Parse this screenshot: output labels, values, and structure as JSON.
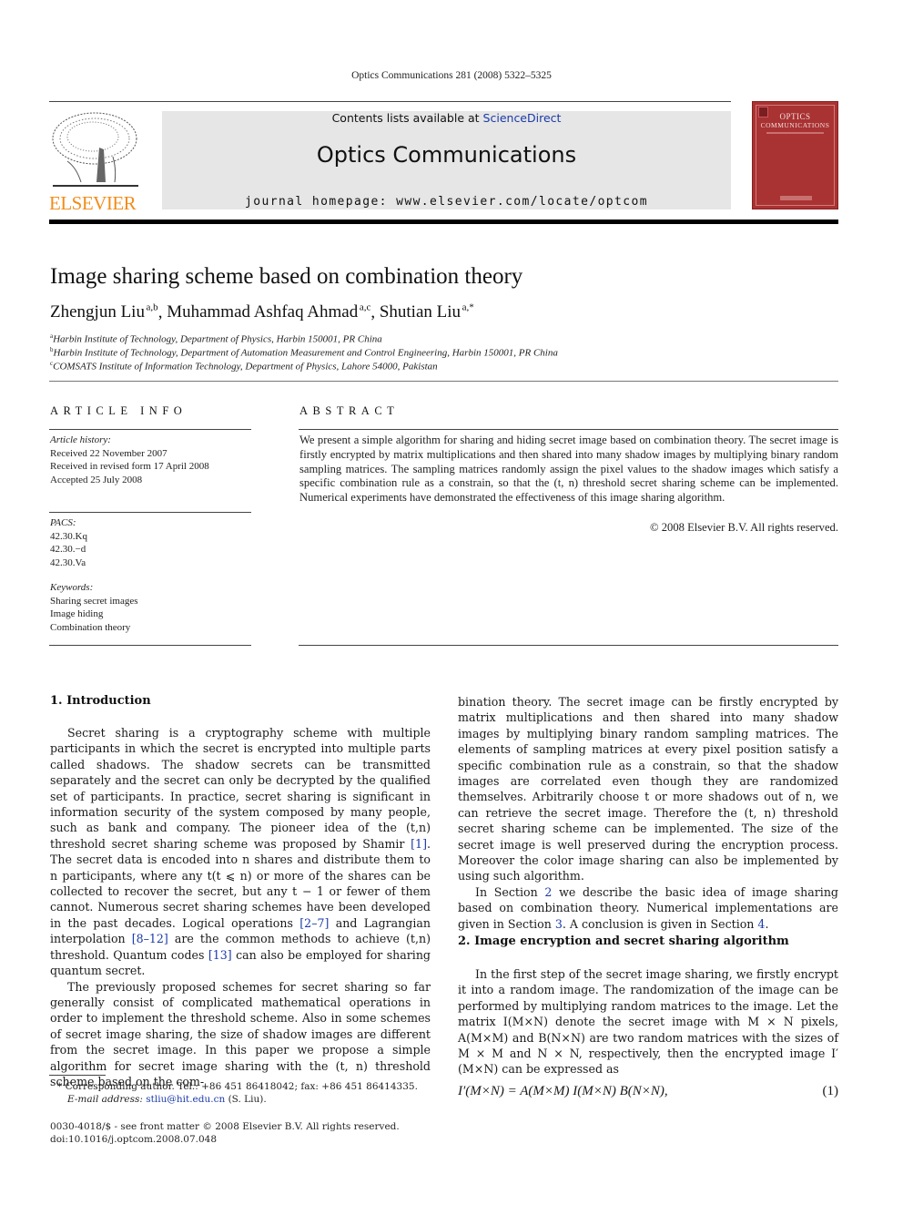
{
  "running_header": "Optics Communications 281 (2008) 5322–5325",
  "banner": {
    "contents_prefix": "Contents lists available at ",
    "contents_link": "ScienceDirect",
    "journal_name": "Optics Communications",
    "homepage": "journal homepage: www.elsevier.com/locate/optcom"
  },
  "publisher_logo": {
    "wordmark": "ELSEVIER",
    "icon": "elsevier-tree-icon",
    "color": "#f28c1a"
  },
  "cover": {
    "title_line1": "Optics",
    "title_line2": "Communications",
    "color": "#a93232"
  },
  "article": {
    "title": "Image sharing scheme based on combination theory",
    "authors": [
      {
        "name": "Zhengjun Liu",
        "sup": "a,b",
        "sep": ", "
      },
      {
        "name": "Muhammad Ashfaq Ahmad",
        "sup": "a,c",
        "sep": ", "
      },
      {
        "name": "Shutian Liu",
        "sup": "a,*",
        "sep": ""
      }
    ],
    "affiliations": [
      {
        "mark": "a",
        "text": "Harbin Institute of Technology, Department of Physics, Harbin 150001, PR China"
      },
      {
        "mark": "b",
        "text": "Harbin Institute of Technology, Department of Automation Measurement and Control Engineering, Harbin 150001, PR China"
      },
      {
        "mark": "c",
        "text": "COMSATS Institute of Information Technology, Department of Physics, Lahore 54000, Pakistan"
      }
    ]
  },
  "article_info": {
    "heading": "ARTICLE INFO",
    "history_label": "Article history:",
    "history": [
      "Received 22 November 2007",
      "Received in revised form 17 April 2008",
      "Accepted 25 July 2008"
    ],
    "pacs_label": "PACS:",
    "pacs": [
      "42.30.Kq",
      "42.30.−d",
      "42.30.Va"
    ],
    "keywords_label": "Keywords:",
    "keywords": [
      "Sharing secret images",
      "Image hiding",
      "Combination theory"
    ]
  },
  "abstract": {
    "heading": "ABSTRACT",
    "text": "We present a simple algorithm for sharing and hiding secret image based on combination theory. The secret image is firstly encrypted by matrix multiplications and then shared into many shadow images by multiplying binary random sampling matrices. The sampling matrices randomly assign the pixel values to the shadow images which satisfy a specific combination rule as a constrain, so that the (t, n) threshold secret sharing scheme can be implemented. Numerical experiments have demonstrated the effectiveness of this image sharing algorithm.",
    "copyright": "© 2008 Elsevier B.V. All rights reserved."
  },
  "section1": {
    "heading": "1. Introduction",
    "p1_a": "Secret sharing is a cryptography scheme with multiple participants in which the secret is encrypted into multiple parts called shadows. The shadow secrets can be transmitted separately and the secret can only be decrypted by the qualified set of participants. In practice, secret sharing is significant in information security of the system composed by many people, such as bank and company. The pioneer idea of the (t,n) threshold secret sharing scheme was proposed by Shamir ",
    "ref1": "[1]",
    "p1_b": ". The secret data is encoded into n shares and distribute them to n participants, where any t(t ⩽ n) or more of the shares can be collected to recover the secret, but any t − 1 or fewer of them cannot. Numerous secret sharing schemes have been developed in the past decades. Logical operations ",
    "ref2": "[2–7]",
    "p1_c": " and Lagrangian interpolation ",
    "ref3": "[8–12]",
    "p1_d": " are the common methods to achieve (t,n) threshold. Quantum codes ",
    "ref4": "[13]",
    "p1_e": " can also be employed for sharing quantum secret.",
    "p2": "The previously proposed schemes for secret sharing so far generally consist of complicated mathematical operations in order to implement the threshold scheme. Also in some schemes of secret image sharing, the size of shadow images are different from the secret image. In this paper we propose a simple algorithm for secret image sharing with the (t, n) threshold scheme based on the com-",
    "p2_cont": "bination theory. The secret image can be firstly encrypted by matrix multiplications and then shared into many shadow images by multiplying binary random sampling matrices. The elements of sampling matrices at every pixel position satisfy a specific combination rule as a constrain, so that the shadow images are correlated even though they are randomized themselves. Arbitrarily choose t or more shadows out of n, we can retrieve the secret image. Therefore the (t, n) threshold secret sharing scheme can be implemented. The size of the secret image is well preserved during the encryption process. Moreover the color image sharing can also be implemented by using such algorithm.",
    "p3_a": "In Section ",
    "p3_s2": "2",
    "p3_b": " we describe the basic idea of image sharing based on combination theory. Numerical implementations are given in Section ",
    "p3_s3": "3",
    "p3_c": ". A conclusion is given in Section ",
    "p3_s4": "4",
    "p3_d": "."
  },
  "section2": {
    "heading": "2. Image encryption and secret sharing algorithm",
    "p1": "In the first step of the secret image sharing, we firstly encrypt it into a random image. The randomization of the image can be performed by multiplying random matrices to the image. Let the matrix I(M×N) denote the secret image with M × N pixels, A(M×M) and B(N×N) are two random matrices with the sizes of M × M and N × N, respectively, then the encrypted image I′(M×N) can be expressed as",
    "equation": "I′(M×N) = A(M×M) I(M×N) B(N×N),",
    "equation_number": "(1)"
  },
  "footnotes": {
    "corresponding": "* Corresponding author. Tel.: +86 451 86418042; fax: +86 451 86414335.",
    "email_label": "E-mail address: ",
    "email": "stliu@hit.edu.cn",
    "email_suffix": " (S. Liu).",
    "issn": "0030-4018/$ - see front matter © 2008 Elsevier B.V. All rights reserved.",
    "doi": "doi:10.1016/j.optcom.2008.07.048"
  }
}
